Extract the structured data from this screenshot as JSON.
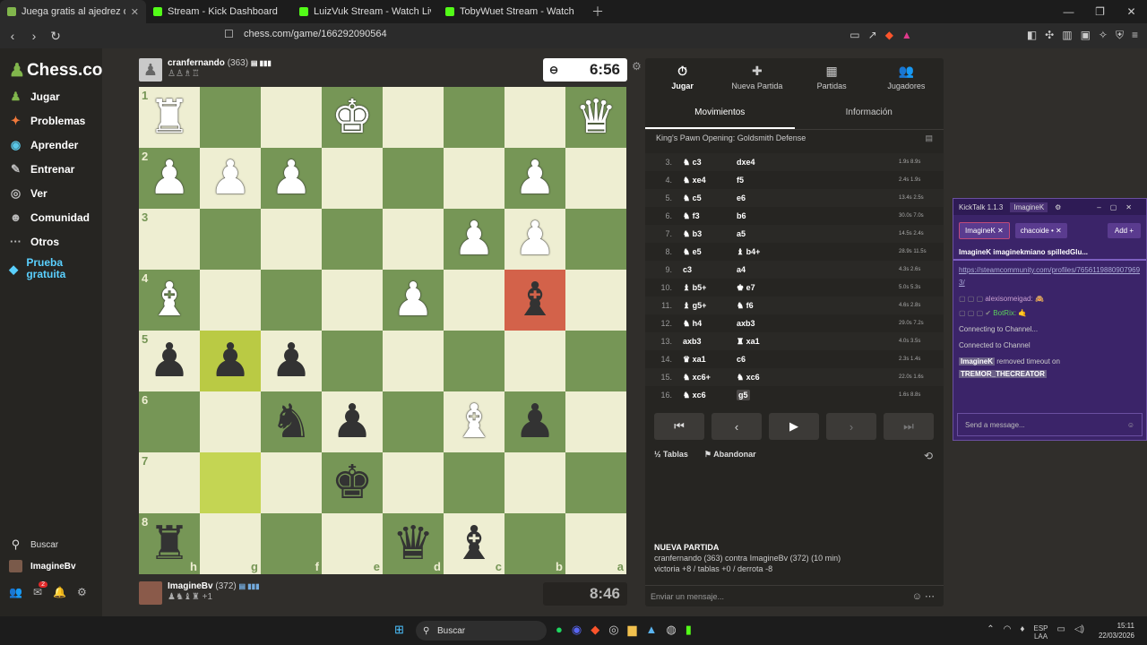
{
  "browser": {
    "tabs": [
      {
        "title": "Juega gratis al ajedrez online co",
        "color": "#81b64c"
      },
      {
        "title": "Stream - Kick Dashboard",
        "color": "#53fc18"
      },
      {
        "title": "LuizVuk Stream - Watch Live on Kick",
        "color": "#53fc18"
      },
      {
        "title": "TobyWuet Stream - Watch Live on Kick",
        "color": "#53fc18"
      }
    ],
    "url": "chess.com/game/166292090564"
  },
  "sidebar": {
    "logo": "Chess.com",
    "items": [
      {
        "label": "Jugar",
        "icon": "♟"
      },
      {
        "label": "Problemas",
        "icon": "✦"
      },
      {
        "label": "Aprender",
        "icon": "◉"
      },
      {
        "label": "Entrenar",
        "icon": "✎"
      },
      {
        "label": "Ver",
        "icon": "◎"
      },
      {
        "label": "Comunidad",
        "icon": "☻"
      },
      {
        "label": "Otros",
        "icon": "···"
      }
    ],
    "promo": "Prueba gratuita",
    "search_label": "Buscar",
    "user": "ImagineBv",
    "mail_badge": "2"
  },
  "top_player": {
    "name": "cranfernando",
    "rating": "(363)",
    "captured": "♙♙♗♖",
    "clock": "6:56"
  },
  "bottom_player": {
    "name": "ImagineBv",
    "rating": "(372)",
    "captured": "♟♞♝♜ +1",
    "clock": "8:46"
  },
  "board": {
    "rank_labels": [
      "1",
      "2",
      "3",
      "4",
      "5",
      "6",
      "7",
      "8"
    ],
    "file_labels": [
      "h",
      "g",
      "f",
      "e",
      "d",
      "c",
      "b",
      "a"
    ],
    "rows": [
      [
        "wR",
        "",
        "",
        "wK",
        "",
        "",
        "",
        "wQ"
      ],
      [
        "wP",
        "wP",
        "wP",
        "",
        "",
        "",
        "wP",
        ""
      ],
      [
        "",
        "",
        "",
        "",
        "",
        "wP",
        "wP",
        ""
      ],
      [
        "wB",
        "",
        "",
        "",
        "wP",
        "",
        "bB",
        ""
      ],
      [
        "bP",
        "bP",
        "bP",
        "",
        "",
        "",
        "",
        ""
      ],
      [
        "",
        "",
        "bN",
        "bP",
        "",
        "wB",
        "bP",
        ""
      ],
      [
        "",
        "",
        "",
        "bK",
        "",
        "",
        "",
        ""
      ],
      [
        "bR",
        "",
        "",
        "",
        "bQ",
        "bB",
        "",
        ""
      ]
    ]
  },
  "panel": {
    "tabs": [
      {
        "label": "Jugar",
        "icon": "⏱"
      },
      {
        "label": "Nueva Partida",
        "icon": "✚"
      },
      {
        "label": "Partidas",
        "icon": "▦"
      },
      {
        "label": "Jugadores",
        "icon": "👥"
      }
    ],
    "subtabs": [
      "Movimientos",
      "Información"
    ],
    "opening": "King's Pawn Opening: Goldsmith Defense",
    "moves": [
      {
        "n": "3.",
        "w": "♞ c3",
        "b": "dxe4",
        "t": "1.9s 8.9s"
      },
      {
        "n": "4.",
        "w": "♞ xe4",
        "b": "f5",
        "t": "2.4s 1.9s"
      },
      {
        "n": "5.",
        "w": "♞ c5",
        "b": "e6",
        "t": "13.4s 2.5s"
      },
      {
        "n": "6.",
        "w": "♞ f3",
        "b": "b6",
        "t": "30.0s 7.0s"
      },
      {
        "n": "7.",
        "w": "♞ b3",
        "b": "a5",
        "t": "14.5s 2.4s"
      },
      {
        "n": "8.",
        "w": "♞ e5",
        "b": "♝ b4+",
        "t": "28.9s 11.5s"
      },
      {
        "n": "9.",
        "w": "c3",
        "b": "a4",
        "t": "4.3s 2.6s"
      },
      {
        "n": "10.",
        "w": "♝ b5+",
        "b": "♚ e7",
        "t": "5.0s 5.3s"
      },
      {
        "n": "11.",
        "w": "♝ g5+",
        "b": "♞ f6",
        "t": "4.6s 2.8s"
      },
      {
        "n": "12.",
        "w": "♞ h4",
        "b": "axb3",
        "t": "29.0s 7.2s"
      },
      {
        "n": "13.",
        "w": "axb3",
        "b": "♜ xa1",
        "t": "4.0s 3.5s"
      },
      {
        "n": "14.",
        "w": "♛ xa1",
        "b": "c6",
        "t": "2.3s 1.4s"
      },
      {
        "n": "15.",
        "w": "♞ xc6+",
        "b": "♞ xc6",
        "t": "22.0s 1.6s"
      },
      {
        "n": "16.",
        "w": "♞ xc6",
        "b": "g5",
        "t": "1.6s 8.8s"
      }
    ],
    "draw_label": "Tablas",
    "resign_label": "Abandonar",
    "newgame_title": "NUEVA PARTIDA",
    "newgame_line1": "cranfernando (363) contra ImagineBv (372) (10 min)",
    "newgame_line2": "victoria +8 / tablas +0 / derrota -8",
    "message_placeholder": "Enviar un mensaje..."
  },
  "kicktalk": {
    "title": "KickTalk 1.1.3",
    "user": "ImagineK",
    "tabs": [
      "ImagineK",
      "chacoide •"
    ],
    "add_label": "Add +",
    "header": "ImagineK   imaginekmiano spilledGlu...",
    "link": "https://steamcommunity.com/profiles/76561198809079693/",
    "msg1": "alexisomeigad:",
    "msg2": "BotRix:",
    "connecting": "Connecting to Channel...",
    "connected": "Connected to Channel",
    "mod_user": "ImagineK",
    "mod_action": "removed timeout on",
    "mod_target": "TREMOR_THECREATOR",
    "input_placeholder": "Send a message..."
  },
  "taskbar": {
    "search": "Buscar",
    "lang": "ESP",
    "region": "LAA",
    "time": "15:11",
    "date": "22/03/2026"
  }
}
